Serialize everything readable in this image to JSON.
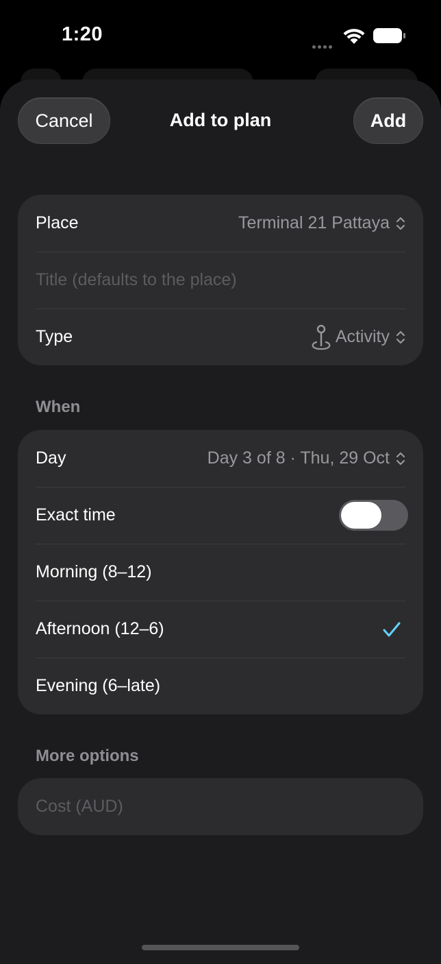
{
  "status_bar": {
    "time": "1:20"
  },
  "nav": {
    "cancel_label": "Cancel",
    "title": "Add to plan",
    "add_label": "Add"
  },
  "place_card": {
    "place_label": "Place",
    "place_value": "Terminal 21 Pattaya",
    "title_placeholder": "Title (defaults to the place)",
    "type_label": "Type",
    "type_value": "Activity",
    "type_icon": "map-pin-icon"
  },
  "when_section": {
    "header": "When",
    "day_label": "Day",
    "day_value": "Day 3 of 8 · Thu, 29 Oct",
    "exact_time_label": "Exact time",
    "exact_time_on": false,
    "slots": [
      {
        "label": "Morning (8–12)",
        "selected": false
      },
      {
        "label": "Afternoon (12–6)",
        "selected": true
      },
      {
        "label": "Evening (6–late)",
        "selected": false
      }
    ],
    "check_color": "#64d2ff"
  },
  "more_section": {
    "header": "More options",
    "cost_placeholder": "Cost (AUD)"
  }
}
